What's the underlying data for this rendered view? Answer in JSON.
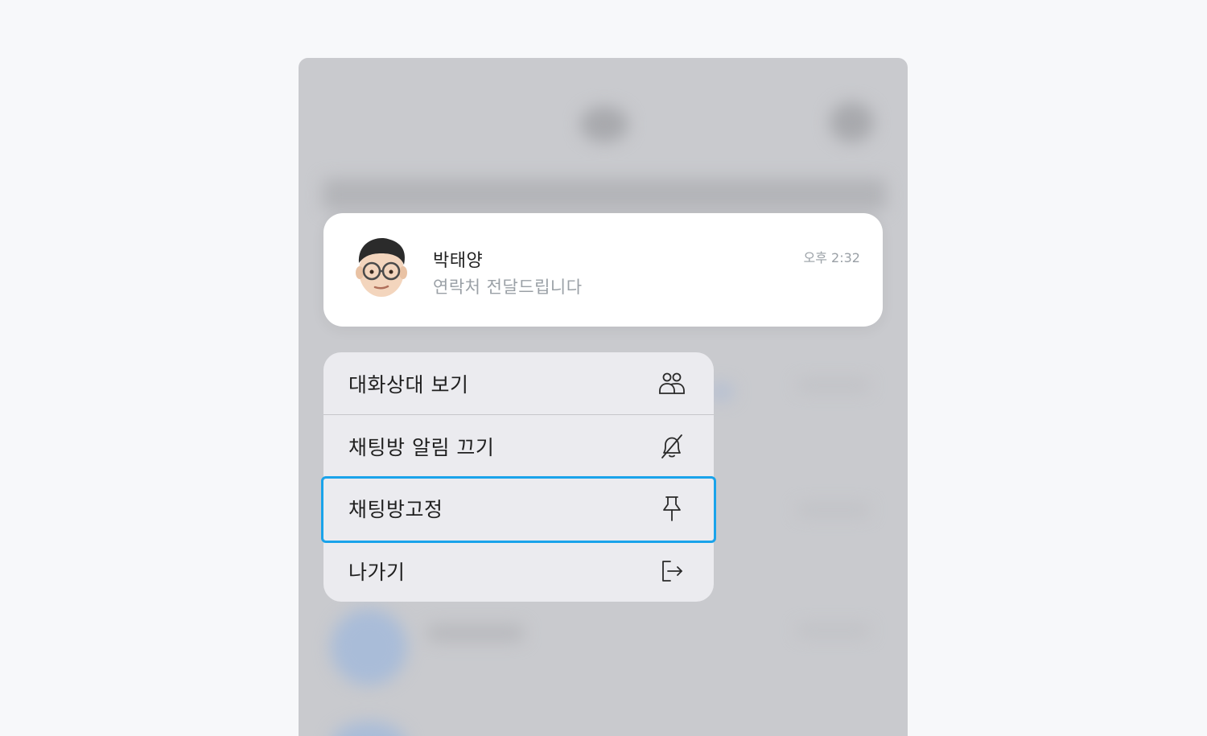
{
  "chat": {
    "name": "박태양",
    "message": "연락처 전달드립니다",
    "time": "오후 2:32",
    "avatar_icon": "memoji-avatar-icon"
  },
  "menu": {
    "items": [
      {
        "label": "대화상대 보기",
        "icon": "people-icon"
      },
      {
        "label": "채팅방 알림 끄기",
        "icon": "bell-off-icon"
      },
      {
        "label": "채팅방고정",
        "icon": "pin-icon",
        "focused": true
      },
      {
        "label": "나가기",
        "icon": "exit-icon"
      }
    ]
  },
  "colors": {
    "focus_ring": "#1aa3ea",
    "menu_bg": "#ebebef",
    "card_bg": "#ffffff",
    "backdrop": "#c9cace"
  }
}
